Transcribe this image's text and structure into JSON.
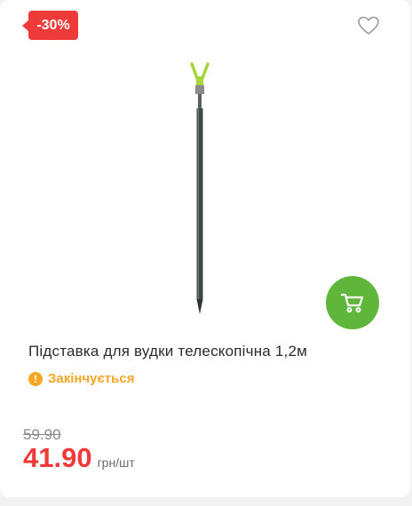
{
  "product": {
    "discount_badge": "-30%",
    "title": "Підставка для вудки телескопічна 1,2м",
    "status": "Закінчується",
    "old_price": "59.90",
    "price": "41.90",
    "unit": "грн/шт"
  },
  "icons": {
    "favorite": "heart-outline-icon",
    "cart": "cart-icon",
    "status": "exclamation-circle-icon"
  },
  "colors": {
    "badge": "#ef3a3a",
    "price": "#ef3a3a",
    "cart_button": "#5fb63a",
    "status": "#f5a623"
  }
}
